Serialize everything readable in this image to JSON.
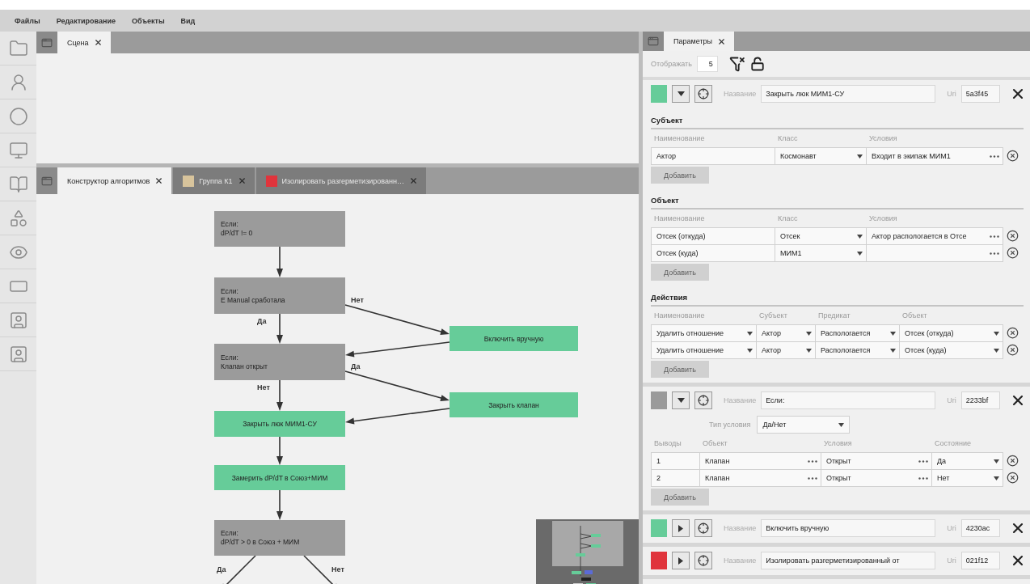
{
  "menu": [
    "Файлы",
    "Редактирование",
    "Объекты",
    "Вид"
  ],
  "scene": {
    "tabs": [
      {
        "label": "Сцена",
        "selected": true
      }
    ]
  },
  "editor": {
    "tabs": [
      {
        "label": "Конструктор алгоритмов",
        "selected": true
      },
      {
        "label": "Группа К1",
        "selected": false,
        "color": "#d8c49c"
      },
      {
        "label": "Изолировать разгерметизированн…",
        "selected": false,
        "color": "#e0343c"
      }
    ],
    "nodes": [
      {
        "kind": "condition",
        "title": "Если:",
        "text": "dP/dT != 0"
      },
      {
        "kind": "condition",
        "title": "Если:",
        "text": "E Manual сработала"
      },
      {
        "kind": "action",
        "text": "Включить вручную"
      },
      {
        "kind": "condition",
        "title": "Если:",
        "text": "Клапан открыт"
      },
      {
        "kind": "action",
        "text": "Закрыть клапан"
      },
      {
        "kind": "action",
        "text": "Закрыть люк МИМ1-СУ"
      },
      {
        "kind": "action",
        "text": "Замерить dP/dT в Союз+МИМ"
      },
      {
        "kind": "condition",
        "title": "Если:",
        "text": "dP/dT > 0 в Союз + МИМ"
      }
    ],
    "edge_labels": [
      {
        "text": "Нет"
      },
      {
        "text": "Да"
      },
      {
        "text": "Да"
      },
      {
        "text": "Нет"
      },
      {
        "text": "Да"
      },
      {
        "text": "Нет"
      }
    ]
  },
  "params": {
    "tabs": [
      {
        "label": "Параметры",
        "selected": true
      }
    ],
    "display_label": "Отображать",
    "display_value": "5",
    "cards": [
      {
        "color": "#66cc99",
        "expanded": true,
        "name_label": "Название",
        "name": "Закрыть люк МИМ1-СУ",
        "uri_label": "Uri",
        "uri": "5a3f45",
        "sections": [
          {
            "kind": "entity",
            "title": "Субъект",
            "columns": [
              "Наименование",
              "Класс",
              "Условия"
            ],
            "rows": [
              [
                {
                  "kind": "text",
                  "text": "Актор"
                },
                {
                  "kind": "select",
                  "text": "Космонавт"
                },
                {
                  "kind": "dots",
                  "text": "Входит в экипаж МИМ1"
                }
              ]
            ],
            "add": "Добавить"
          },
          {
            "kind": "entity",
            "title": "Объект",
            "columns": [
              "Наименование",
              "Класс",
              "Условия"
            ],
            "rows": [
              [
                {
                  "kind": "text",
                  "text": "Отсек (откуда)"
                },
                {
                  "kind": "select",
                  "text": "Отсек"
                },
                {
                  "kind": "dots",
                  "text": "Актор распологается в Отсе"
                }
              ],
              [
                {
                  "kind": "text",
                  "text": "Отсек (куда)"
                },
                {
                  "kind": "select",
                  "text": "МИМ1"
                },
                {
                  "kind": "dots"
                }
              ]
            ],
            "add": "Добавить"
          },
          {
            "kind": "action",
            "title": "Действия",
            "columns": [
              "Наименование",
              "Субъект",
              "Предикат",
              "Объект"
            ],
            "rows": [
              [
                {
                  "kind": "select",
                  "text": "Удалить отношение"
                },
                {
                  "kind": "select",
                  "text": "Актор"
                },
                {
                  "kind": "select",
                  "text": "Распологается"
                },
                {
                  "kind": "select",
                  "text": "Отсек (откуда)"
                }
              ],
              [
                {
                  "kind": "select",
                  "text": "Удалить отношение"
                },
                {
                  "kind": "select",
                  "text": "Актор"
                },
                {
                  "kind": "select",
                  "text": "Распологается"
                },
                {
                  "kind": "select",
                  "text": "Отсек (куда)"
                }
              ]
            ],
            "add": "Добавить"
          }
        ]
      },
      {
        "color": "#9a9a9a",
        "expanded": true,
        "name_label": "Название",
        "name": "Если:",
        "uri_label": "Uri",
        "uri": "2233bf",
        "condition": {
          "label": "Тип условия",
          "value": "Да/Нет"
        },
        "sections": [
          {
            "kind": "output",
            "columns": [
              "Выводы",
              "Объект",
              "Условия",
              "Состояние"
            ],
            "rows": [
              [
                {
                  "kind": "text",
                  "text": "1"
                },
                {
                  "kind": "dots",
                  "text": "Клапан"
                },
                {
                  "kind": "dots",
                  "text": "Открыт"
                },
                {
                  "kind": "select",
                  "text": "Да"
                }
              ],
              [
                {
                  "kind": "text",
                  "text": "2"
                },
                {
                  "kind": "dots",
                  "text": "Клапан"
                },
                {
                  "kind": "dots",
                  "text": "Открыт"
                },
                {
                  "kind": "select",
                  "text": "Нет"
                }
              ]
            ],
            "add": "Добавить"
          }
        ]
      },
      {
        "color": "#66cc99",
        "expanded": false,
        "name_label": "Название",
        "name": "Включить вручную",
        "uri_label": "Uri",
        "uri": "4230ac"
      },
      {
        "color": "#e0343c",
        "expanded": false,
        "name_label": "Название",
        "name": "Изолировать разгерметизированный от",
        "uri_label": "Uri",
        "uri": "021f12"
      }
    ]
  }
}
